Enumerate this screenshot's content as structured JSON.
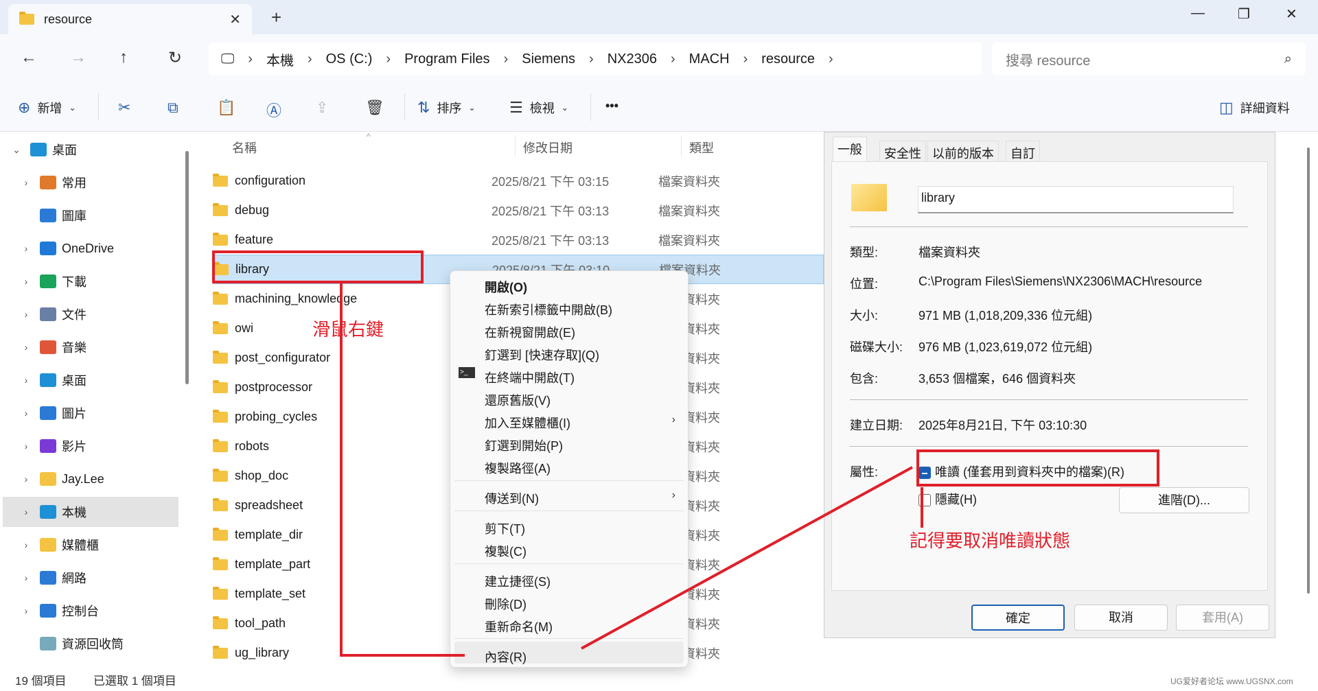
{
  "window": {
    "tab_title": "resource",
    "minimize": "—",
    "maximize": "❐",
    "close": "✕",
    "new_tab": "+"
  },
  "nav": {
    "back": "←",
    "forward": "→",
    "up": "↑",
    "refresh": "↻"
  },
  "address": {
    "segments": [
      "本機",
      "OS (C:)",
      "Program Files",
      "Siemens",
      "NX2306",
      "MACH",
      "resource"
    ],
    "sep": "›",
    "search_placeholder": "搜尋 resource"
  },
  "toolbar": {
    "new": "新增",
    "sort": "排序",
    "view": "檢視",
    "more": "•••",
    "details": "詳細資料"
  },
  "sidebar": [
    {
      "label": "桌面",
      "color": "#1e90d6"
    },
    {
      "label": "常用",
      "color": "#e07a2a"
    },
    {
      "label": "圖庫",
      "color": "#2a7ad6"
    },
    {
      "label": "OneDrive",
      "color": "#1e7ad6"
    },
    {
      "label": "下載",
      "color": "#1aa35a"
    },
    {
      "label": "文件",
      "color": "#6a7fa6"
    },
    {
      "label": "音樂",
      "color": "#e0563a"
    },
    {
      "label": "桌面",
      "color": "#1e90d6"
    },
    {
      "label": "圖片",
      "color": "#2a7ad6"
    },
    {
      "label": "影片",
      "color": "#7a3ad6"
    },
    {
      "label": "Jay.Lee",
      "color": "#f5c342"
    },
    {
      "label": "本機",
      "color": "#1e90d6"
    },
    {
      "label": "媒體櫃",
      "color": "#f5c342"
    },
    {
      "label": "網路",
      "color": "#2a7ad6"
    },
    {
      "label": "控制台",
      "color": "#2a7ad6"
    },
    {
      "label": "資源回收筒",
      "color": "#7ab"
    }
  ],
  "columns": {
    "name": "名稱",
    "date": "修改日期",
    "type": "類型"
  },
  "files": [
    {
      "name": "configuration",
      "date": "2025/8/21 下午 03:15",
      "type": "檔案資料夾"
    },
    {
      "name": "debug",
      "date": "2025/8/21 下午 03:13",
      "type": "檔案資料夾"
    },
    {
      "name": "feature",
      "date": "2025/8/21 下午 03:13",
      "type": "檔案資料夾"
    },
    {
      "name": "library",
      "date": "2025/8/21 下午 03:10",
      "type": "檔案資料夾"
    },
    {
      "name": "machining_knowledge",
      "date": "",
      "type": "檔案資料夾"
    },
    {
      "name": "owi",
      "date": "",
      "type": "檔案資料夾"
    },
    {
      "name": "post_configurator",
      "date": "",
      "type": "檔案資料夾"
    },
    {
      "name": "postprocessor",
      "date": "",
      "type": "檔案資料夾"
    },
    {
      "name": "probing_cycles",
      "date": "",
      "type": "檔案資料夾"
    },
    {
      "name": "robots",
      "date": "",
      "type": "檔案資料夾"
    },
    {
      "name": "shop_doc",
      "date": "",
      "type": "檔案資料夾"
    },
    {
      "name": "spreadsheet",
      "date": "",
      "type": "檔案資料夾"
    },
    {
      "name": "template_dir",
      "date": "",
      "type": "檔案資料夾"
    },
    {
      "name": "template_part",
      "date": "",
      "type": "檔案資料夾"
    },
    {
      "name": "template_set",
      "date": "",
      "type": "檔案資料夾"
    },
    {
      "name": "tool_path",
      "date": "",
      "type": "檔案資料夾"
    },
    {
      "name": "ug_library",
      "date": "",
      "type": "檔案資料夾"
    }
  ],
  "menu": [
    "開啟(O)",
    "在新索引標籤中開啟(B)",
    "在新視窗開啟(E)",
    "釘選到 [快速存取](Q)",
    "在終端中開啟(T)",
    "還原舊版(V)",
    "加入至媒體櫃(I)",
    "釘選到開始(P)",
    "複製路徑(A)",
    "傳送到(N)",
    "剪下(T)",
    "複製(C)",
    "建立捷徑(S)",
    "刪除(D)",
    "重新命名(M)",
    "內容(R)"
  ],
  "dialog": {
    "tabs": [
      "一般",
      "安全性",
      "以前的版本",
      "自訂"
    ],
    "name": "library",
    "labels": {
      "type": "類型:",
      "location": "位置:",
      "size": "大小:",
      "disk_size": "磁碟大小:",
      "contains": "包含:",
      "created": "建立日期:",
      "attributes": "屬性:"
    },
    "values": {
      "type": "檔案資料夾",
      "location": "C:\\Program Files\\Siemens\\NX2306\\MACH\\resource",
      "size": "971 MB (1,018,209,336 位元組)",
      "disk_size": "976 MB (1,023,619,072 位元組)",
      "contains": "3,653 個檔案，646 個資料夾",
      "created": "2025年8月21日, 下午 03:10:30"
    },
    "readonly": "唯讀 (僅套用到資料夾中的檔案)(R)",
    "hidden": "隱藏(H)",
    "advanced": "進階(D)...",
    "ok": "確定",
    "cancel": "取消",
    "apply": "套用(A)"
  },
  "annotations": {
    "right_click": "滑鼠右鍵",
    "uncheck_readonly": "記得要取消唯讀狀態"
  },
  "status": {
    "count": "19 個項目",
    "selected": "已選取 1 個項目"
  },
  "watermark": "UG爱好者论坛 www.UGSNX.com"
}
